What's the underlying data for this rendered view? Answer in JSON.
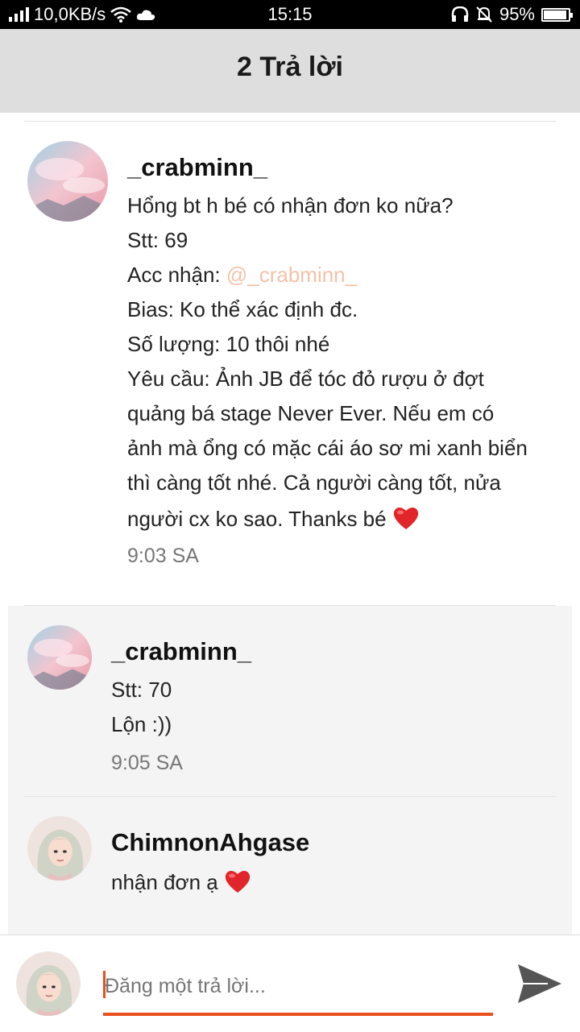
{
  "status_bar": {
    "network_speed": "10,0KB/s",
    "time": "15:15",
    "battery": "95%",
    "battery_level": 0.95,
    "icons": [
      "signal-icon",
      "wifi-icon",
      "cloud-icon",
      "headset-icon",
      "mute-bell-icon",
      "battery-icon"
    ]
  },
  "header": {
    "title": "2 Trả lời"
  },
  "post": {
    "username": "_crabminn_",
    "lines": [
      "Hổng bt h bé có nhận đơn ko nữa?",
      "Stt: 69",
      "Acc nhận: ",
      "Bias: Ko thể xác định đc.",
      "Số lượng: 10 thôi nhé",
      "Yêu cầu: Ảnh JB để tóc đỏ rượu ở đợt",
      "quảng bá stage Never Ever. Nếu em có",
      "ảnh mà ổng có mặc cái áo sơ mi xanh biển",
      "thì càng tốt nhé. Cả người càng tốt, nửa",
      "người cx ko sao. Thanks bé "
    ],
    "mention": "@_crabminn_",
    "timestamp": "9:03 SA"
  },
  "replies": [
    {
      "username": "_crabminn_",
      "lines": [
        "Stt: 70",
        "Lộn :))"
      ],
      "timestamp": "9:05 SA"
    },
    {
      "username": "ChimnonAhgase",
      "lines": [
        "nhận đơn ạ "
      ]
    }
  ],
  "composer": {
    "placeholder": "Đăng một trả lời...",
    "accent_color": "#e8501c"
  },
  "colors": {
    "header_bg": "#dedede",
    "reply_bg": "#f4f4f4",
    "mention": "#f5c1a8",
    "heart": "#e0262b"
  }
}
